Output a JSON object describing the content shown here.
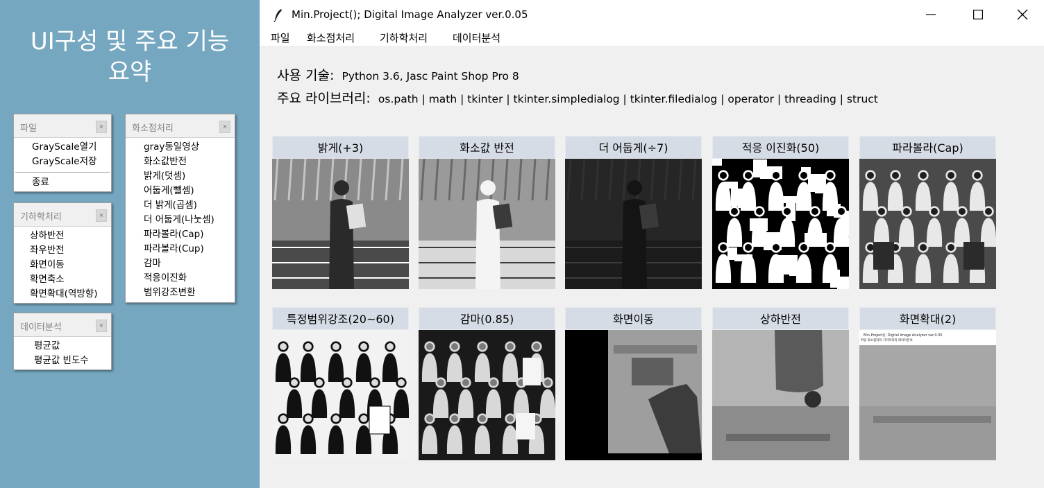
{
  "slide": {
    "title_line1": "UI구성 및 주요 기능",
    "title_line2": "요약",
    "background_color": "#76a7c0"
  },
  "menus": {
    "file": {
      "header": "파일",
      "items": [
        "GrayScale열기",
        "GrayScale저장"
      ],
      "extra": [
        "종료"
      ]
    },
    "geometry": {
      "header": "기하학처리",
      "items": [
        "상하반전",
        "좌우반전",
        "화면이동",
        "확면축소",
        "확면확대(역방향)"
      ]
    },
    "data_analysis": {
      "header": "데이터분석",
      "items": [
        "평균값",
        "평균값 빈도수"
      ]
    },
    "pixel": {
      "header": "화소점처리",
      "items": [
        "gray동일영상",
        "화소값반전",
        "밝게(덧셈)",
        "어둡게(뺄셈)",
        "더 밝게(곱셈)",
        "더 어둡게(나눗셈)",
        "파라볼라(Cap)",
        "파라볼라(Cup)",
        "감마",
        "적응이진화",
        "범위강조변환"
      ]
    }
  },
  "window": {
    "title": "Min.Project(); Digital Image Analyzer ver.0.05",
    "icons": {
      "app": "feather-icon",
      "minimize": "minimize-icon",
      "maximize": "maximize-icon",
      "close": "close-icon"
    },
    "menubar": [
      "파일",
      "화소점처리",
      "기하학처리",
      "데이터분석"
    ]
  },
  "info": {
    "tech_label": "사용 기술:",
    "tech_value": "Python 3.6, Jasc Paint Shop Pro 8",
    "libs_label": "주요 라이브러리:",
    "libs_value": "os.path | math | tkinter | tkinter.simpledialog | tkinter.filedialog | operator | threading | struct"
  },
  "tiles": [
    {
      "label": "밝게(+3)",
      "variant": "bright"
    },
    {
      "label": "화소값 반전",
      "variant": "invert"
    },
    {
      "label": "더 어둡게(÷7)",
      "variant": "dark"
    },
    {
      "label": "적응 이진화(50)",
      "variant": "binary"
    },
    {
      "label": "파라볼라(Cap)",
      "variant": "cap"
    },
    {
      "label": "특정범위강조(20~60)",
      "variant": "range"
    },
    {
      "label": "감마(0.85)",
      "variant": "gamma"
    },
    {
      "label": "화면이동",
      "variant": "move"
    },
    {
      "label": "상하반전",
      "variant": "flip"
    },
    {
      "label": "화면확대(2)",
      "variant": "zoom"
    }
  ],
  "zoom_preview": {
    "title": "Min.Project(); Digital Image Analyzer ver.0.05",
    "menu": "파일   화소점처리   기하학처리   데이터분석"
  }
}
